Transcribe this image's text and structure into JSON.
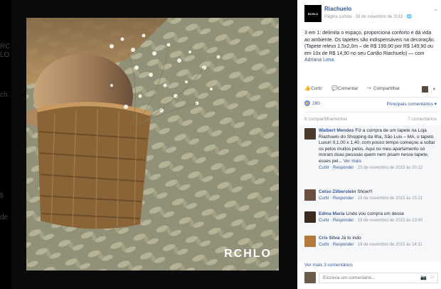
{
  "left_fragments": [
    "RC",
    "LO",
    "ch",
    "fi",
    "de"
  ],
  "photo": {
    "watermark": "RCHLO"
  },
  "post": {
    "page_name": "Riachuelo",
    "logo_text": "RCHLO",
    "meta": "Página curtida · 19 de novembro de 2015 · 🌐",
    "text": "3 em 1: delimita o espaço, proporciona conforto e dá vida ao ambiente. Os tapetes são indispensáveis na decoração. (Tapete relevo 1,5x2,0m – de R$ 199,90 por R$ 149,90 ou em 10x de R$ 14,90 no seu Cartão Riachuelo) — com",
    "tagged": "Adriana Lima."
  },
  "actions": {
    "like": "Curtir",
    "comment": "Comentar",
    "share": "Compartilhar"
  },
  "reactions": {
    "count": "280",
    "main_comments": "Principais comentários ▾"
  },
  "summary": {
    "shares": "6 compartilhamentos",
    "comments": "7 comentários"
  },
  "comments": [
    {
      "name": "Walbert Mendes",
      "text": "Fiz a compra de um tapete na Loja Riachuelo do Shopping da Ilha, São Luis – MA, o tapeto Luxuri II,1,00 x 1,40, com pouco tempo começou a soltar os pelos muitos pelos. Aqui no meu apartamento só moram duas pessoas quem nem pisam nesse tapete, esses pel...",
      "more": "Ver mais",
      "like": "Curtir",
      "reply": "Responder",
      "date": "23 de novembro de 2015 às 20:12"
    },
    {
      "name": "Celso Zilberstein",
      "text": "Show!!!",
      "like": "Curtir",
      "reply": "Responder",
      "date": "19 de novembro de 2015 às 15:21"
    },
    {
      "name": "Edma Maria",
      "text": "Lindo vou compra um desse",
      "like": "Curtir",
      "reply": "Responder",
      "date": "19 de novembro de 2015 às 13:40"
    },
    {
      "name": "Cris Silva",
      "text": "Já to indo",
      "like": "Curtir",
      "reply": "Responder",
      "date": "19 de novembro de 2015 às 14:11"
    }
  ],
  "view_more": "Ver mais 3 comentários",
  "write": {
    "placeholder": "Escreva um comentário..."
  },
  "colors": {
    "facebook_blue": "#365899",
    "like_blue": "#5890ff"
  }
}
